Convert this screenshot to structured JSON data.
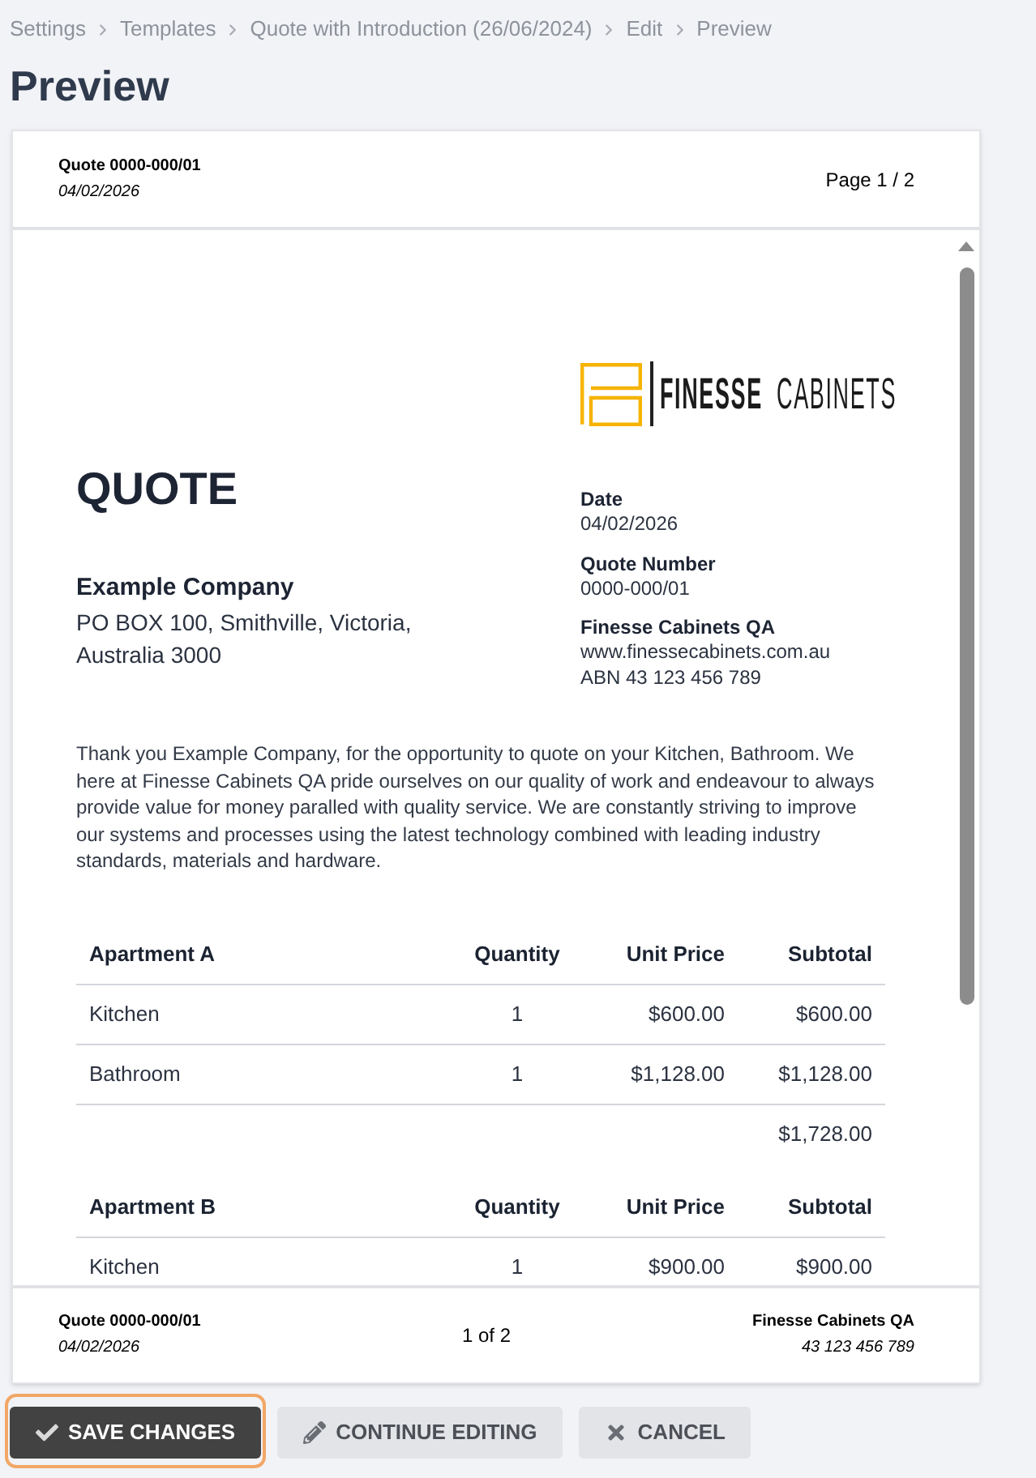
{
  "breadcrumb": [
    "Settings",
    "Templates",
    "Quote with Introduction (26/06/2024)",
    "Edit",
    "Preview"
  ],
  "page_title": "Preview",
  "preview": {
    "page_header": {
      "quote_ref": "Quote 0000-000/01",
      "date": "04/02/2026",
      "page": "Page 1 / 2"
    },
    "document": {
      "logo": {
        "wordmark": "**FINESSE** CABINETS"
      },
      "title": "QUOTE",
      "client": {
        "name": "Example Company",
        "address": "PO BOX 100, Smithville, Victoria, Australia 3000"
      },
      "details": [
        {
          "label": "Date",
          "lines": [
            "04/02/2026"
          ]
        },
        {
          "label": "Quote Number",
          "lines": [
            "0000-000/01"
          ]
        },
        {
          "label": "Finesse Cabinets QA",
          "lines": [
            "www.finessecabinets.com.au",
            "ABN 43 123 456 789"
          ]
        }
      ],
      "introduction": "Thank you Example Company, for the opportunity to quote on your Kitchen, Bathroom. We here at Finesse Cabinets QA pride ourselves on our quality of work and endeavour to always provide value for money paralled with quality service. We are constantly striving to improve our systems and processes using the latest technology combined with leading industry standards, materials and hardware.",
      "sections": [
        {
          "columns": [
            "Apartment A",
            "Quantity",
            "Unit Price",
            "Subtotal"
          ],
          "rows": [
            [
              "Kitchen",
              "1",
              "$600.00",
              "$600.00"
            ],
            [
              "Bathroom",
              "1",
              "$1,128.00",
              "$1,128.00"
            ]
          ],
          "total": "$1,728.00"
        },
        {
          "columns": [
            "Apartment B",
            "Quantity",
            "Unit Price",
            "Subtotal"
          ],
          "rows": [
            [
              "Kitchen",
              "1",
              "$900.00",
              "$900.00"
            ]
          ]
        }
      ]
    },
    "page_footer": {
      "quote_ref": "Quote 0000-000/01",
      "date": "04/02/2026",
      "page": "1 of 2",
      "company": "Finesse Cabinets QA",
      "abn": "43 123 456 789"
    }
  },
  "buttons": [
    {
      "kind": "save",
      "label": "SAVE CHANGES",
      "focused": true
    },
    {
      "kind": "edit",
      "label": "CONTINUE EDITING",
      "focused": false
    },
    {
      "kind": "cancel",
      "label": "CANCEL",
      "focused": false
    }
  ]
}
